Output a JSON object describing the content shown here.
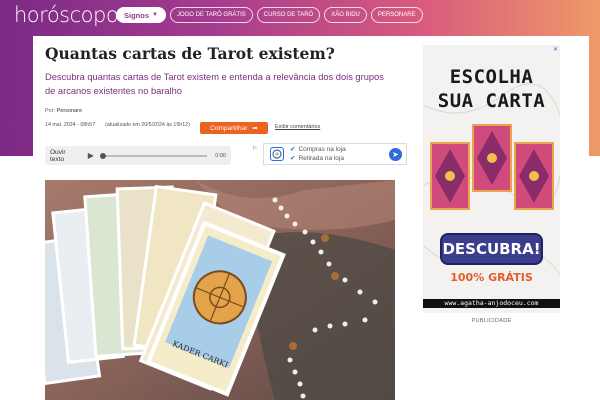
{
  "header": {
    "logo": "horóscopo",
    "nav": {
      "active_label": "Signos",
      "items": [
        "JOGO DE TARÔ GRÁTIS",
        "CURSO DE TARÔ",
        "XÃO BIDU",
        "PERSONARE"
      ]
    },
    "gradient_colors": [
      "#7b2a86",
      "#a43c8e",
      "#d85a7e",
      "#ee9a68"
    ]
  },
  "article": {
    "title": "Quantas cartas de Tarot existem?",
    "subtitle": "Descubra quantas cartas de Tarot existem e entenda a relevância dos dois grupos de arcanos existentes no baralho",
    "byline_prefix": "Por:",
    "author": "Personare",
    "date": "14 mai. 2024 - 08h57",
    "updated": "(atualizado em 20/5/2024 às 15h12)",
    "share_label": "Compartilhar",
    "comments_label": "Exibir comentários",
    "share_color": "#ec6220"
  },
  "audio": {
    "label": "Ouvir texto",
    "time": "0:00"
  },
  "shopping_ad": {
    "lines": [
      "Compras na loja",
      "Retirada na loja"
    ]
  },
  "side_ad": {
    "headline_1": "ESCOLHA",
    "headline_2": "SUA CARTA",
    "cta": "DESCUBRA!",
    "free": "100% GRÁTIS",
    "url": "www.agatha-anjodoceu.com",
    "footer": "PUBLICIDADE"
  },
  "photo": {
    "card_caption": "KADER CARKI"
  }
}
